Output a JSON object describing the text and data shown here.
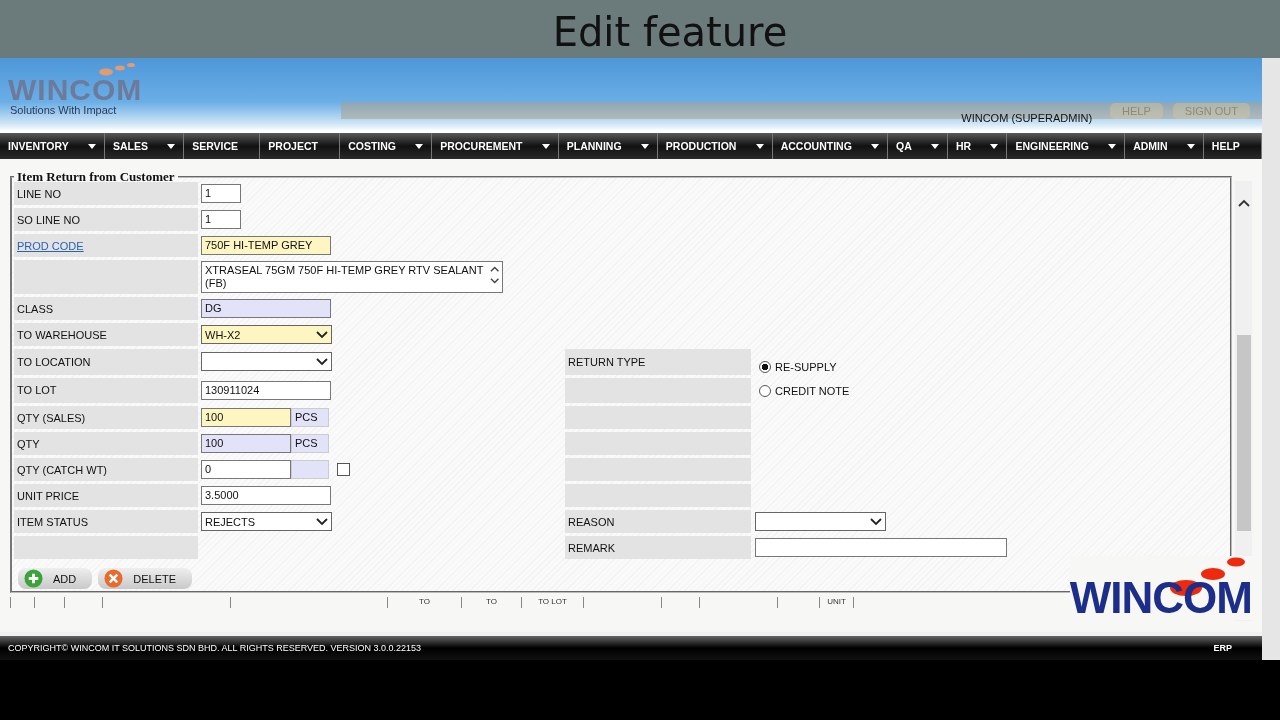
{
  "caption": "Edit feature",
  "header": {
    "logo": "WINCOM",
    "tagline": "Solutions With Impact",
    "user": "WINCOM (SUPERADMIN)",
    "links": [
      "HELP",
      "SIGN OUT"
    ]
  },
  "nav": [
    {
      "label": "INVENTORY",
      "has_menu": true
    },
    {
      "label": "SALES",
      "has_menu": true
    },
    {
      "label": "SERVICE",
      "has_menu": false
    },
    {
      "label": "PROJECT",
      "has_menu": false
    },
    {
      "label": "COSTING",
      "has_menu": true
    },
    {
      "label": "PROCUREMENT",
      "has_menu": true
    },
    {
      "label": "PLANNING",
      "has_menu": true
    },
    {
      "label": "PRODUCTION",
      "has_menu": true
    },
    {
      "label": "ACCOUNTING",
      "has_menu": true
    },
    {
      "label": "QA",
      "has_menu": true
    },
    {
      "label": "HR",
      "has_menu": true
    },
    {
      "label": "ENGINEERING",
      "has_menu": true
    },
    {
      "label": "ADMIN",
      "has_menu": true
    },
    {
      "label": "HELP",
      "has_menu": false
    }
  ],
  "form": {
    "legend": "Item Return from Customer",
    "rows": [
      {
        "left": {
          "label": "LINE NO",
          "kind": "short_input",
          "value": "1",
          "color": "#ffffff"
        }
      },
      {
        "left": {
          "label": "SO LINE NO",
          "kind": "short_input",
          "value": "1",
          "color": "#ffffff"
        }
      },
      {
        "left": {
          "label": "PROD CODE",
          "link": true,
          "kind": "input",
          "value": "750F HI-TEMP GREY",
          "color": "#fdf6c3"
        }
      },
      {
        "left": {
          "kind": "textarea",
          "value": "XTRASEAL 75GM 750F HI-TEMP GREY RTV SEALANT (FB)"
        }
      },
      {
        "left": {
          "label": "CLASS",
          "kind": "input",
          "value": "DG",
          "color": "#e2e2f8"
        }
      },
      {
        "left": {
          "label": "TO WAREHOUSE",
          "kind": "select",
          "value": "WH-X2",
          "color": "#fdf6c3"
        }
      },
      {
        "left": {
          "label": "TO LOCATION",
          "kind": "select",
          "color": "#ffffff"
        },
        "right": {
          "label": "RETURN TYPE",
          "kind": "radio",
          "options": [
            {
              "label": "RE-SUPPLY",
              "selected": true
            },
            {
              "label": "CREDIT NOTE",
              "selected": false
            }
          ]
        }
      },
      {
        "left": {
          "label": "TO LOT",
          "kind": "input",
          "value": "130911024",
          "color": "#ffffff"
        },
        "right": {
          "kind": "blank"
        }
      },
      {
        "left": {
          "label": "QTY (SALES)",
          "kind": "input_unit",
          "value": "100",
          "unit": "PCS",
          "color": "#fdf6c3"
        },
        "right": {
          "kind": "blank"
        }
      },
      {
        "left": {
          "label": "QTY",
          "kind": "input_unit",
          "value": "100",
          "unit": "PCS",
          "color": "#e2e2f8"
        },
        "right": {
          "kind": "blank"
        }
      },
      {
        "left": {
          "label": "QTY (CATCH WT)",
          "kind": "input_unit",
          "value": "0",
          "color": "#ffffff",
          "checked": false
        },
        "right": {
          "kind": "blank"
        }
      },
      {
        "left": {
          "label": "UNIT PRICE",
          "kind": "input",
          "value": "3.5000",
          "color": "#ffffff"
        },
        "right": {
          "kind": "blank"
        }
      },
      {
        "left": {
          "label": "ITEM STATUS",
          "kind": "select",
          "value": "REJECTS",
          "color": "#ffffff"
        },
        "right": {
          "label": "REASON",
          "kind": "select",
          "color": "#ffffff"
        }
      },
      {
        "left": {
          "kind": "blank"
        },
        "right": {
          "label": "REMARK",
          "kind": "long_input",
          "color": "#ffffff"
        }
      }
    ],
    "buttons": [
      {
        "label": "ADD",
        "kind": "add"
      },
      {
        "label": "DELETE",
        "kind": "delete"
      }
    ]
  },
  "table_columns": [
    {
      "kind": "blank"
    },
    {
      "kind": "blank"
    },
    {
      "kind": "blank"
    },
    {
      "kind": "blank"
    },
    {
      "kind": "blank"
    },
    {
      "kind": "text",
      "label": "TO"
    },
    {
      "kind": "text",
      "label": "TO"
    },
    {
      "kind": "text",
      "label": "TO LOT"
    },
    {
      "kind": "blank"
    },
    {
      "kind": "blank"
    },
    {
      "kind": "blank"
    },
    {
      "kind": "blank"
    },
    {
      "kind": "text",
      "label": "UNIT"
    },
    {
      "kind": "blank"
    }
  ],
  "brand": "WINCOM",
  "footer": {
    "copyright": "COPYRIGHT© WINCOM IT SOLUTIONS SDN BHD. ALL RIGHTS RESERVED.  VERSION 3.0.0.22153",
    "product": "ERP"
  }
}
